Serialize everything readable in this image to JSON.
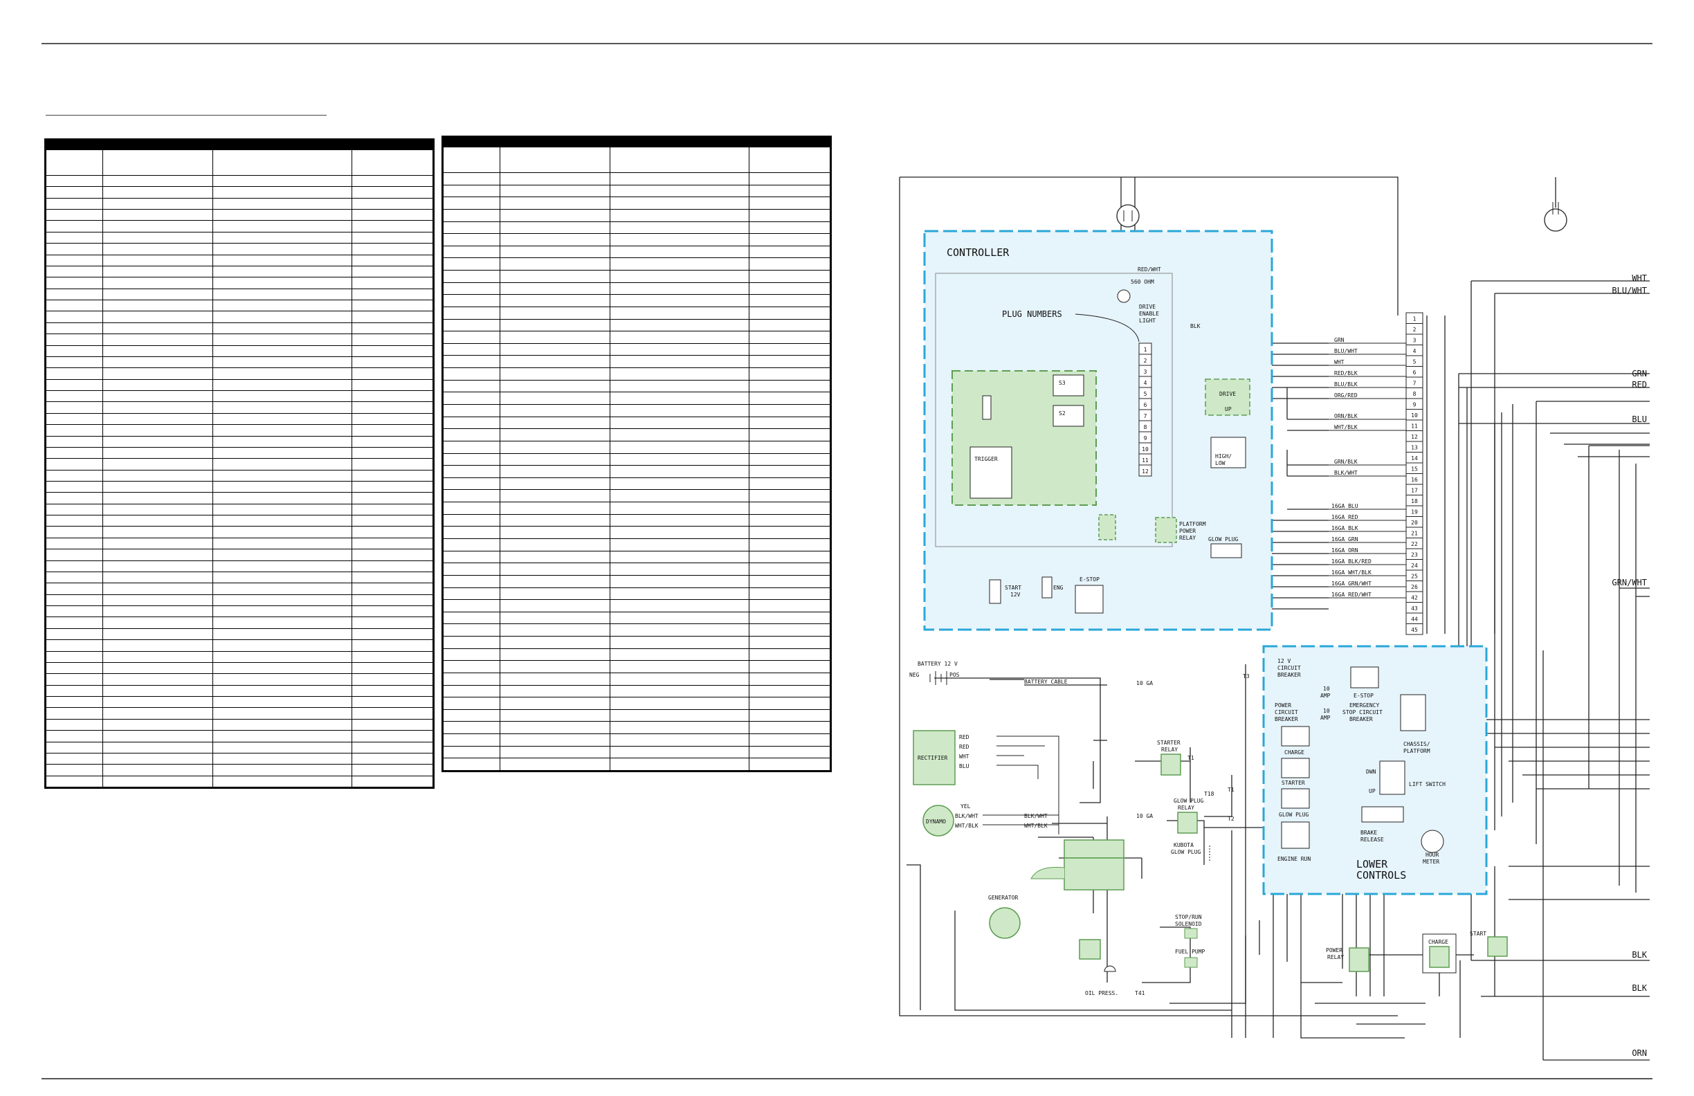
{
  "page": {
    "background": "#ffffff"
  },
  "colors": {
    "box_fill": "#e6f4fb",
    "box_border": "#2aa7d8",
    "component_fill": "#cfe9c8",
    "component_border": "#5d9c52",
    "wire": "#222222"
  },
  "tables": {
    "left_table": {
      "row_count": 54,
      "column_count": 4
    },
    "right_table": {
      "row_count": 49,
      "column_count": 4
    }
  },
  "diagram": {
    "controller": {
      "title": "CONTROLLER",
      "drive_enable": {
        "resistor": "560 OHM",
        "wire": "RED/WHT",
        "label_lines": [
          "DRIVE",
          "ENABLE",
          "LIGHT"
        ]
      },
      "plug_numbers_label": "PLUG NUMBERS",
      "plug_pins": [
        "1",
        "2",
        "3",
        "4",
        "5",
        "6",
        "7",
        "8",
        "9",
        "10",
        "11",
        "12"
      ],
      "switches": [
        "S3",
        "S2",
        "TRIGGER"
      ],
      "drive_switch": [
        "DRIVE",
        "UP"
      ],
      "speed_switch": [
        "HIGH/",
        "LOW"
      ],
      "platform_relay_lines": [
        "PLATFORM",
        "POWER",
        "RELAY"
      ],
      "glow_plug": "GLOW PLUG",
      "start": [
        "START",
        "12V"
      ],
      "eng": "ENG",
      "estop": "E-STOP",
      "blk_wire": "BLK"
    },
    "terminal_strip": {
      "pins": [
        "1",
        "2",
        "3",
        "4",
        "5",
        "6",
        "7",
        "8",
        "9",
        "10",
        "11",
        "12",
        "13",
        "14",
        "15",
        "16",
        "17",
        "18",
        "19",
        "20",
        "21",
        "22",
        "23",
        "24",
        "25",
        "26",
        "42",
        "43",
        "44",
        "45"
      ],
      "wire_labels": [
        "GRN",
        "BLU/WHT",
        "WHT",
        "RED/BLK",
        "BLU/BLK",
        "ORG/RED",
        "ORN/BLK",
        "WHT/BLK",
        "GRN/BLK",
        "BLK/WHT",
        "16GA BLU",
        "16GA RED",
        "16GA BLK",
        "16GA GRN",
        "16GA ORN",
        "16GA BLK/RED",
        "16GA WHT/BLK",
        "16GA GRN/WHT",
        "16GA RED/WHT"
      ]
    },
    "right_edge_labels": [
      "WHT",
      "BLU/WHT",
      "GRN",
      "RED",
      "BLU",
      "GRN/WHT",
      "BLK",
      "BLK",
      "ORN"
    ],
    "battery": {
      "label": "BATTERY 12 V",
      "neg": "NEG",
      "pos": "POS",
      "cable": "BATTERY CABLE",
      "gauge": "10 GA",
      "t3": "T3"
    },
    "rectifier": {
      "label": "RECTIFIER",
      "wires": [
        "RED",
        "RED",
        "WHT",
        "BLU"
      ]
    },
    "dynamo": {
      "label": "DYNAMO",
      "wires": [
        "YEL",
        "BLK/WHT",
        "WHT/BLK"
      ],
      "out_wires": [
        "BLK/WHT",
        "WHT/BLK"
      ]
    },
    "starter_relay": {
      "lines": [
        "STARTER",
        "RELAY"
      ],
      "t1": "T1"
    },
    "glow_plug_relay": {
      "lines": [
        "GLOW PLUG",
        "RELAY"
      ],
      "t18": "T18",
      "gauge": "10 GA"
    },
    "kubota": [
      "KUBOTA",
      "GLOW PLUG"
    ],
    "generator": "GENERATOR",
    "stop_run": [
      "STOP/RUN",
      "SOLENOID"
    ],
    "fuel_pump": "FUEL PUMP",
    "oil_press": "OIL PRESS.",
    "t41": "T41",
    "t1b": "T1",
    "t2": "T2",
    "lower_controls": {
      "title_lines": [
        "LOWER",
        "CONTROLS"
      ],
      "circuit_breaker": [
        "12 V",
        "CIRCUIT",
        "BREAKER"
      ],
      "amp10a": [
        "10",
        "AMP"
      ],
      "amp10b": [
        "10",
        "AMP"
      ],
      "estop": "E-STOP",
      "power_cb": [
        "POWER",
        "CIRCUIT",
        "BREAKER"
      ],
      "emergency_cb": [
        "EMERGENCY",
        "STOP CIRCUIT",
        "BREAKER"
      ],
      "chassis": [
        "CHASSIS/",
        "PLATFORM"
      ],
      "charge": "CHARGE",
      "starter": "STARTER",
      "glow_plug": "GLOW PLUG",
      "engine_run": "ENGINE RUN",
      "dwn": "DWN",
      "up": "UP",
      "lift_switch": "LIFT SWITCH",
      "brake_release": [
        "BRAKE",
        "RELEASE"
      ],
      "hour_meter": [
        "HOUR",
        "METER"
      ]
    },
    "power_relay": [
      "POWER",
      "RELAY"
    ],
    "charge_relay": "CHARGE",
    "start_relay": "START"
  }
}
